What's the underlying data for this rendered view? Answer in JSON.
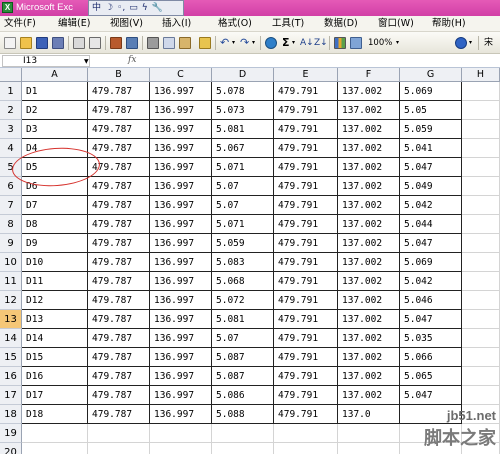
{
  "window": {
    "title": "Microsoft Exc",
    "ime": [
      "中",
      "☽",
      "◦,",
      "▭",
      "ϟ",
      "🔧"
    ]
  },
  "menu": [
    "文件(F)",
    "编辑(E)",
    "视图(V)",
    "插入(I)",
    "格式(O)",
    "工具(T)",
    "数据(D)",
    "窗口(W)",
    "帮助(H)"
  ],
  "toolbar": {
    "zoom": "100%",
    "autosum": "Σ",
    "font_name": "宋"
  },
  "formula_bar": {
    "name_box": "I13",
    "fx": "fx"
  },
  "sheet": {
    "columns": [
      "A",
      "B",
      "C",
      "D",
      "E",
      "F",
      "G",
      "H"
    ],
    "active_row": 13,
    "rows": [
      {
        "n": "1",
        "cells": [
          "D1",
          "479.787",
          "136.997",
          "5.078",
          "479.791",
          "137.002",
          "5.069"
        ]
      },
      {
        "n": "2",
        "cells": [
          "D2",
          "479.787",
          "136.997",
          "5.073",
          "479.791",
          "137.002",
          "5.05"
        ]
      },
      {
        "n": "3",
        "cells": [
          "D3",
          "479.787",
          "136.997",
          "5.081",
          "479.791",
          "137.002",
          "5.059"
        ]
      },
      {
        "n": "4",
        "cells": [
          "D4",
          "479.787",
          "136.997",
          "5.067",
          "479.791",
          "137.002",
          "5.041"
        ]
      },
      {
        "n": "5",
        "cells": [
          "D5",
          "479.787",
          "136.997",
          "5.071",
          "479.791",
          "137.002",
          "5.047"
        ]
      },
      {
        "n": "6",
        "cells": [
          "D6",
          "479.787",
          "136.997",
          "5.07",
          "479.791",
          "137.002",
          "5.049"
        ]
      },
      {
        "n": "7",
        "cells": [
          "D7",
          "479.787",
          "136.997",
          "5.07",
          "479.791",
          "137.002",
          "5.042"
        ]
      },
      {
        "n": "8",
        "cells": [
          "D8",
          "479.787",
          "136.997",
          "5.071",
          "479.791",
          "137.002",
          "5.044"
        ]
      },
      {
        "n": "9",
        "cells": [
          "D9",
          "479.787",
          "136.997",
          "5.059",
          "479.791",
          "137.002",
          "5.047"
        ]
      },
      {
        "n": "10",
        "cells": [
          "D10",
          "479.787",
          "136.997",
          "5.083",
          "479.791",
          "137.002",
          "5.069"
        ]
      },
      {
        "n": "11",
        "cells": [
          "D11",
          "479.787",
          "136.997",
          "5.068",
          "479.791",
          "137.002",
          "5.042"
        ]
      },
      {
        "n": "12",
        "cells": [
          "D12",
          "479.787",
          "136.997",
          "5.072",
          "479.791",
          "137.002",
          "5.046"
        ]
      },
      {
        "n": "13",
        "cells": [
          "D13",
          "479.787",
          "136.997",
          "5.081",
          "479.791",
          "137.002",
          "5.047"
        ]
      },
      {
        "n": "14",
        "cells": [
          "D14",
          "479.787",
          "136.997",
          "5.07",
          "479.791",
          "137.002",
          "5.035"
        ]
      },
      {
        "n": "15",
        "cells": [
          "D15",
          "479.787",
          "136.997",
          "5.087",
          "479.791",
          "137.002",
          "5.066"
        ]
      },
      {
        "n": "16",
        "cells": [
          "D16",
          "479.787",
          "136.997",
          "5.087",
          "479.791",
          "137.002",
          "5.065"
        ]
      },
      {
        "n": "17",
        "cells": [
          "D17",
          "479.787",
          "136.997",
          "5.086",
          "479.791",
          "137.002",
          "5.047"
        ]
      },
      {
        "n": "18",
        "cells": [
          "D18",
          "479.787",
          "136.997",
          "5.088",
          "479.791",
          "137.0",
          ""
        ]
      },
      {
        "n": "19",
        "cells": []
      },
      {
        "n": "20",
        "cells": []
      }
    ]
  },
  "watermark": {
    "site": "jb51.net",
    "name": "脚本之家"
  },
  "colors": {
    "titlebar": "#d13fa6",
    "annotation_circle": "#d6322d",
    "active_row_header": "#f5c777"
  }
}
